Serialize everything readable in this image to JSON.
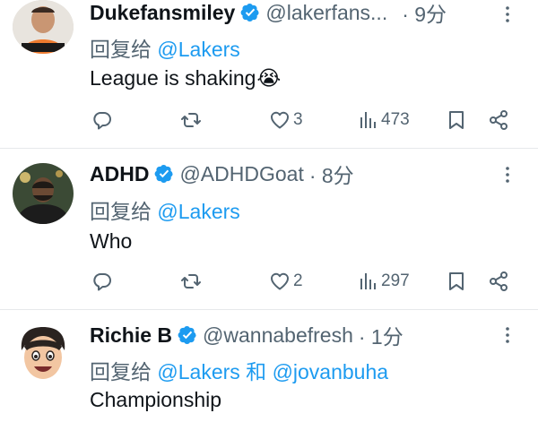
{
  "reply_prefix": "回复给",
  "tweets": [
    {
      "name": "Dukefansmiley",
      "handle": "@lakerfans...",
      "time": "· 9分",
      "mentions": [
        "@Lakers"
      ],
      "joiner": "",
      "text": "League is shaking",
      "emoji": "😭",
      "likes": "3",
      "views": "473"
    },
    {
      "name": "ADHD",
      "handle": "@ADHDGoat",
      "time": "· 8分",
      "mentions": [
        "@Lakers"
      ],
      "joiner": "",
      "text": "Who",
      "emoji": "",
      "likes": "2",
      "views": "297"
    },
    {
      "name": "Richie B",
      "handle": "@wannabefresh",
      "time": "· 1分",
      "mentions": [
        "@Lakers",
        "@jovanbuha"
      ],
      "joiner": "和",
      "text": "Championship",
      "emoji": "",
      "likes": "",
      "views": ""
    }
  ],
  "colors": {
    "text": "#0f1419",
    "muted": "#536471",
    "link": "#1d9bf0",
    "verified": "#1d9bf0",
    "divider": "#e6e9eb"
  },
  "icons": [
    "verified-badge-icon",
    "more-options-icon",
    "reply-icon",
    "retweet-icon",
    "like-icon",
    "views-icon",
    "bookmark-icon",
    "share-icon"
  ]
}
